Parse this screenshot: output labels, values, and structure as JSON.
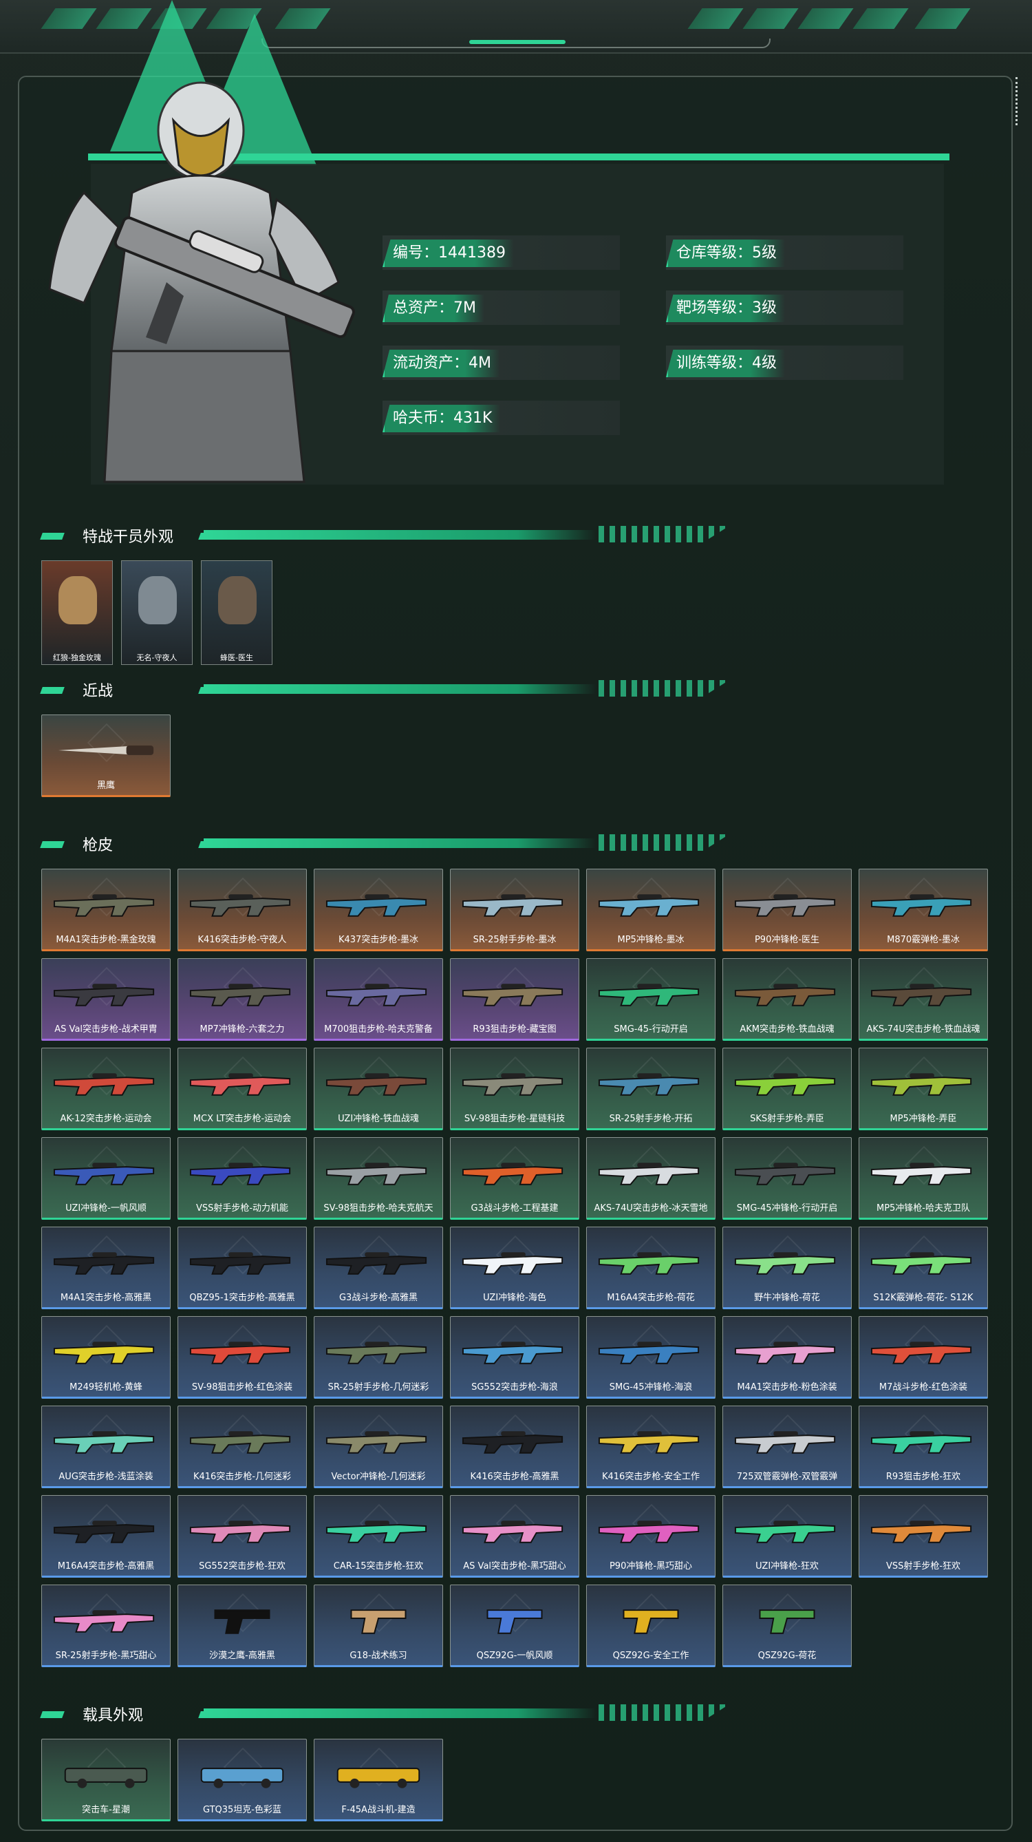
{
  "player": {
    "labels": [
      {
        "k": "编号：",
        "v": "1441389"
      },
      {
        "k": "总资产：",
        "v": "7M"
      },
      {
        "k": "流动资产：",
        "v": "4M"
      },
      {
        "k": "哈夫币：",
        "v": "431K"
      },
      {
        "k": "仓库等级：",
        "v": "5级"
      },
      {
        "k": "靶场等级：",
        "v": "3级"
      },
      {
        "k": "训练等级：",
        "v": "4级"
      }
    ]
  },
  "sections": {
    "operators": "特战干员外观",
    "melee": "近战",
    "guns": "枪皮",
    "vehicles": "载具外观"
  },
  "operators": [
    "红狼-独金玫瑰",
    "无名-守夜人",
    "蜂医-医生"
  ],
  "melee": [
    {
      "name": "黑鹰",
      "rarity": "orange"
    }
  ],
  "guns": [
    {
      "name": "M4A1突击步枪-黑金玫瑰",
      "rarity": "orange"
    },
    {
      "name": "K416突击步枪-守夜人",
      "rarity": "orange"
    },
    {
      "name": "K437突击步枪-墨冰",
      "rarity": "orange"
    },
    {
      "name": "SR-25射手步枪-墨冰",
      "rarity": "orange"
    },
    {
      "name": "MP5冲锋枪-墨冰",
      "rarity": "orange"
    },
    {
      "name": "P90冲锋枪-医生",
      "rarity": "orange"
    },
    {
      "name": "M870霰弹枪-墨冰",
      "rarity": "orange"
    },
    {
      "name": "AS Val突击步枪-战术甲胄",
      "rarity": "purple"
    },
    {
      "name": "MP7冲锋枪-六套之力",
      "rarity": "purple"
    },
    {
      "name": "M700狙击步枪-哈夫克警备",
      "rarity": "purple"
    },
    {
      "name": "R93狙击步枪-藏宝图",
      "rarity": "purple"
    },
    {
      "name": "SMG-45-行动开启",
      "rarity": "green"
    },
    {
      "name": "AKM突击步枪-铁血战魂",
      "rarity": "green"
    },
    {
      "name": "AKS-74U突击步枪-铁血战魂",
      "rarity": "green"
    },
    {
      "name": "AK-12突击步枪-运动会",
      "rarity": "green"
    },
    {
      "name": "MCX LT突击步枪-运动会",
      "rarity": "green"
    },
    {
      "name": "UZI冲锋枪-铁血战魂",
      "rarity": "green"
    },
    {
      "name": "SV-98狙击步枪-星链科技",
      "rarity": "green"
    },
    {
      "name": "SR-25射手步枪-开拓",
      "rarity": "green"
    },
    {
      "name": "SKS射手步枪-弄臣",
      "rarity": "green"
    },
    {
      "name": "MP5冲锋枪-弄臣",
      "rarity": "green"
    },
    {
      "name": "UZI冲锋枪-一帆风顺",
      "rarity": "green"
    },
    {
      "name": "VSS射手步枪-动力机能",
      "rarity": "green"
    },
    {
      "name": "SV-98狙击步枪-哈夫克航天",
      "rarity": "green"
    },
    {
      "name": "G3战斗步枪-工程基建",
      "rarity": "green"
    },
    {
      "name": "AKS-74U突击步枪-冰天雪地",
      "rarity": "green"
    },
    {
      "name": "SMG-45冲锋枪-行动开启",
      "rarity": "green"
    },
    {
      "name": "MP5冲锋枪-哈夫克卫队",
      "rarity": "green"
    },
    {
      "name": "M4A1突击步枪-高雅黑",
      "rarity": "blue"
    },
    {
      "name": "QBZ95-1突击步枪-高雅黑",
      "rarity": "blue"
    },
    {
      "name": "G3战斗步枪-高雅黑",
      "rarity": "blue"
    },
    {
      "name": "UZI冲锋枪-海色",
      "rarity": "blue"
    },
    {
      "name": "M16A4突击步枪-荷花",
      "rarity": "blue"
    },
    {
      "name": "野牛冲锋枪-荷花",
      "rarity": "blue"
    },
    {
      "name": "S12K霰弹枪-荷花- S12K",
      "rarity": "blue"
    },
    {
      "name": "M249轻机枪-黄蜂",
      "rarity": "blue"
    },
    {
      "name": "SV-98狙击步枪-红色涂装",
      "rarity": "blue"
    },
    {
      "name": "SR-25射手步枪-几何迷彩",
      "rarity": "blue"
    },
    {
      "name": "SG552突击步枪-海浪",
      "rarity": "blue"
    },
    {
      "name": "SMG-45冲锋枪-海浪",
      "rarity": "blue"
    },
    {
      "name": "M4A1突击步枪-粉色涂装",
      "rarity": "blue"
    },
    {
      "name": "M7战斗步枪-红色涂装",
      "rarity": "blue"
    },
    {
      "name": "AUG突击步枪-浅蓝涂装",
      "rarity": "blue"
    },
    {
      "name": "K416突击步枪-几何迷彩",
      "rarity": "blue"
    },
    {
      "name": "Vector冲锋枪-几何迷彩",
      "rarity": "blue"
    },
    {
      "name": "K416突击步枪-高雅黑",
      "rarity": "blue"
    },
    {
      "name": "K416突击步枪-安全工作",
      "rarity": "blue"
    },
    {
      "name": "725双管霰弹枪-双管霰弹",
      "rarity": "blue"
    },
    {
      "name": "R93狙击步枪-狂欢",
      "rarity": "blue"
    },
    {
      "name": "M16A4突击步枪-高雅黑",
      "rarity": "blue"
    },
    {
      "name": "SG552突击步枪-狂欢",
      "rarity": "blue"
    },
    {
      "name": "CAR-15突击步枪-狂欢",
      "rarity": "blue"
    },
    {
      "name": "AS Val突击步枪-黑巧甜心",
      "rarity": "blue"
    },
    {
      "name": "P90冲锋枪-黑巧甜心",
      "rarity": "blue"
    },
    {
      "name": "UZI冲锋枪-狂欢",
      "rarity": "blue"
    },
    {
      "name": "VSS射手步枪-狂欢",
      "rarity": "blue"
    },
    {
      "name": "SR-25射手步枪-黑巧甜心",
      "rarity": "blue"
    },
    {
      "name": "沙漠之鹰-高雅黑",
      "rarity": "blue"
    },
    {
      "name": "G18-战术练习",
      "rarity": "blue"
    },
    {
      "name": "QSZ92G-一帆风顺",
      "rarity": "blue"
    },
    {
      "name": "QSZ92G-安全工作",
      "rarity": "blue"
    },
    {
      "name": "QSZ92G-荷花",
      "rarity": "blue"
    }
  ],
  "vehicles": [
    {
      "name": "突击车-星潮",
      "rarity": "green"
    },
    {
      "name": "GTQ35坦克-色彩蓝",
      "rarity": "blue"
    },
    {
      "name": "F-45A战斗机-建造",
      "rarity": "blue"
    }
  ],
  "colors": {
    "accent": "#2fd596",
    "orange": "#e07a32",
    "purple": "#a06ae0",
    "green": "#2fd596",
    "blue": "#5a9ae8"
  }
}
